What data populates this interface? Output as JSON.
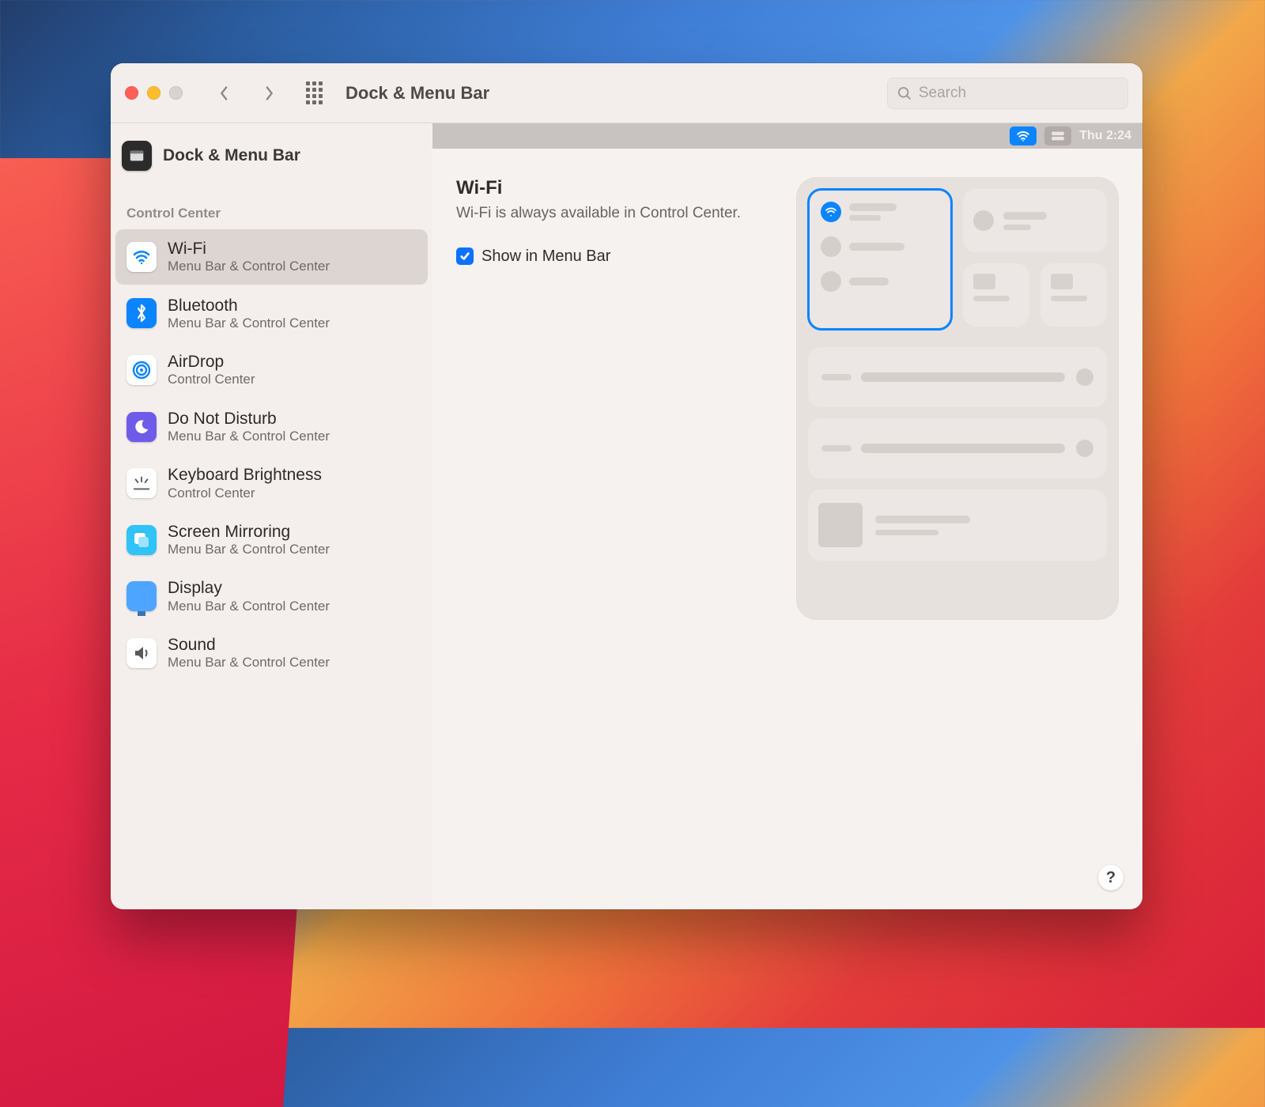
{
  "header": {
    "title": "Dock & Menu Bar",
    "search_placeholder": "Search"
  },
  "sidebar": {
    "header_label": "Dock & Menu Bar",
    "section_label": "Control Center",
    "items": [
      {
        "label": "Wi-Fi",
        "sub": "Menu Bar & Control Center",
        "selected": true
      },
      {
        "label": "Bluetooth",
        "sub": "Menu Bar & Control Center",
        "selected": false
      },
      {
        "label": "AirDrop",
        "sub": "Control Center",
        "selected": false
      },
      {
        "label": "Do Not Disturb",
        "sub": "Menu Bar & Control Center",
        "selected": false
      },
      {
        "label": "Keyboard Brightness",
        "sub": "Control Center",
        "selected": false
      },
      {
        "label": "Screen Mirroring",
        "sub": "Menu Bar & Control Center",
        "selected": false
      },
      {
        "label": "Display",
        "sub": "Menu Bar & Control Center",
        "selected": false
      },
      {
        "label": "Sound",
        "sub": "Menu Bar & Control Center",
        "selected": false
      }
    ]
  },
  "menubar_strip": {
    "time": "Thu 2:24"
  },
  "detail": {
    "title": "Wi-Fi",
    "description": "Wi-Fi is always available in Control Center.",
    "checkbox_label": "Show in Menu Bar",
    "checkbox_checked": true
  },
  "help_button": "?"
}
